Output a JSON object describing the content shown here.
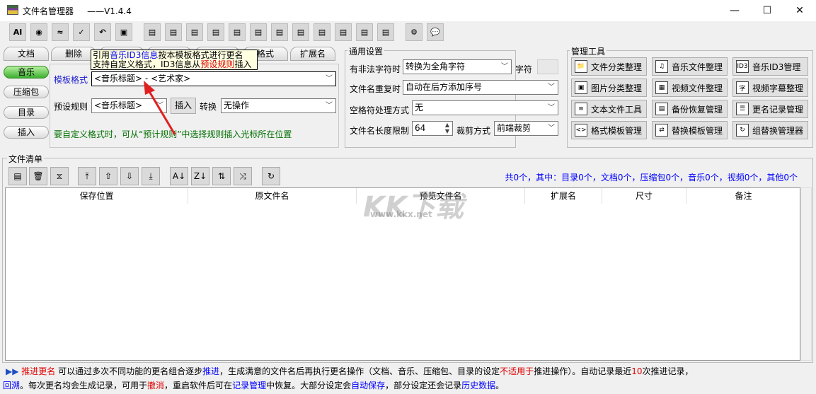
{
  "window": {
    "title": "文件名管理器",
    "version": "——V1.4.4",
    "minimize": "—",
    "maximize": "☐",
    "close": "✕"
  },
  "toolbar": {
    "left": [
      "ai-icon",
      "eye-icon",
      "wave-icon",
      "check-icon",
      "undo-icon",
      "save-clock-icon"
    ],
    "middle": [
      "folder-icon",
      "music-file-icon",
      "id3-icon",
      "image-icon",
      "video-icon",
      "subtitle-icon",
      "text-file-icon",
      "backup-icon",
      "notepad-icon",
      "format-template-icon",
      "replace-template-icon",
      "group-replace-icon"
    ],
    "right": [
      "gear-icon",
      "chat-icon"
    ]
  },
  "tabs": [
    "文档",
    "删除",
    "",
    "",
    "",
    "格式",
    "扩展名"
  ],
  "side_tabs": [
    "音乐",
    "压缩包",
    "目录",
    "插入"
  ],
  "tooltip": {
    "l1a": "引用",
    "l1b": "音乐ID3信息",
    "l1c": "按本模板格式进行更名",
    "l2a": "支持自定义格式，ID3信息从",
    "l2b": "预设规则",
    "l2c": "插入"
  },
  "music": {
    "template_label": "模板格式",
    "template_value": "<音乐标题> - <艺术家>",
    "preset_label": "预设规则",
    "preset_value": "<音乐标题>",
    "insert": "插入",
    "convert_label": "转换",
    "convert_value": "无操作",
    "hint": "要自定义格式时，可从“预计规则”中选择规则插入光标所在位置"
  },
  "general": {
    "title": "通用设置",
    "illegal_label": "有非法字符时",
    "illegal_value": "转换为全角字符",
    "char_label": "字符",
    "char_value": "",
    "dup_label": "文件名重复时",
    "dup_value": "自动在后方添加序号",
    "space_label": "空格符处理方式",
    "space_value": "无",
    "len_label": "文件名长度限制",
    "len_value": "64",
    "trim_label": "裁剪方式",
    "trim_value": "前端裁剪"
  },
  "tools": {
    "title": "管理工具",
    "items": [
      {
        "label": "文件分类整理",
        "icon": "folder-icon",
        "glyph": "📁"
      },
      {
        "label": "音乐文件整理",
        "icon": "music-file-icon",
        "glyph": "♫"
      },
      {
        "label": "音乐ID3管理",
        "icon": "id3-icon",
        "glyph": "ID3"
      },
      {
        "label": "图片分类整理",
        "icon": "image-icon",
        "glyph": "▣"
      },
      {
        "label": "视频文件整理",
        "icon": "video-icon",
        "glyph": "▦"
      },
      {
        "label": "视频字幕整理",
        "icon": "subtitle-icon",
        "glyph": "字"
      },
      {
        "label": "文本文件工具",
        "icon": "text-file-icon",
        "glyph": "≡"
      },
      {
        "label": "备份恢复管理",
        "icon": "backup-icon",
        "glyph": "▤"
      },
      {
        "label": "更名记录管理",
        "icon": "notepad-icon",
        "glyph": "☰"
      },
      {
        "label": "格式模板管理",
        "icon": "format-template-icon",
        "glyph": "<>"
      },
      {
        "label": "替换模板管理",
        "icon": "replace-template-icon",
        "glyph": "⇄"
      },
      {
        "label": "组替换管理器",
        "icon": "group-replace-icon",
        "glyph": "↻"
      }
    ]
  },
  "filelist": {
    "title": "文件清单",
    "summary": "共0个，其中：目录0个，文档0个，压缩包0个，音乐0个，视频0个，其他0个",
    "buttons": [
      {
        "icon": "add-files-icon",
        "g": "▤"
      },
      {
        "icon": "trash-icon",
        "g": "🗑"
      },
      {
        "icon": "clear-icon",
        "g": "⧖"
      },
      {
        "icon": "move-top-icon",
        "g": "⤒"
      },
      {
        "icon": "move-up-icon",
        "g": "⇧"
      },
      {
        "icon": "move-down-icon",
        "g": "⇩"
      },
      {
        "icon": "move-bottom-icon",
        "g": "⤓"
      },
      {
        "icon": "sort-az-icon",
        "g": "A↓"
      },
      {
        "icon": "sort-za-icon",
        "g": "Z↓"
      },
      {
        "icon": "reverse-icon",
        "g": "⇅"
      },
      {
        "icon": "shuffle-icon",
        "g": "⤨"
      },
      {
        "icon": "refresh-icon",
        "g": "↻"
      }
    ],
    "columns": [
      "保存位置",
      "原文件名",
      "预览文件名",
      "扩展名",
      "尺寸",
      "备注"
    ]
  },
  "watermark": {
    "logo": "KK下载",
    "url": "www.kkx.net"
  },
  "status": {
    "s1": "推进更名",
    "s2": " 可以通过多次不同功能的更名组合逐步",
    "s3": "推进",
    "s4": "，生成满意的文件名后再执行更名操作（文档、音乐、压缩包、目录的设定",
    "s5": "不适用于",
    "s6": "推进操作）。自动记录最近",
    "s7": "10",
    "s8": "次推进记录，",
    "t1": "回溯",
    "t2": "。每次更名均会生成记录，可用于",
    "t3": "撤消",
    "t4": "，重启软件后可在",
    "t5": "记录管理",
    "t6": "中恢复。大部分设定会",
    "t7": "自动保存",
    "t8": "，部分设定还会记录",
    "t9": "历史数据",
    "t10": "。"
  }
}
